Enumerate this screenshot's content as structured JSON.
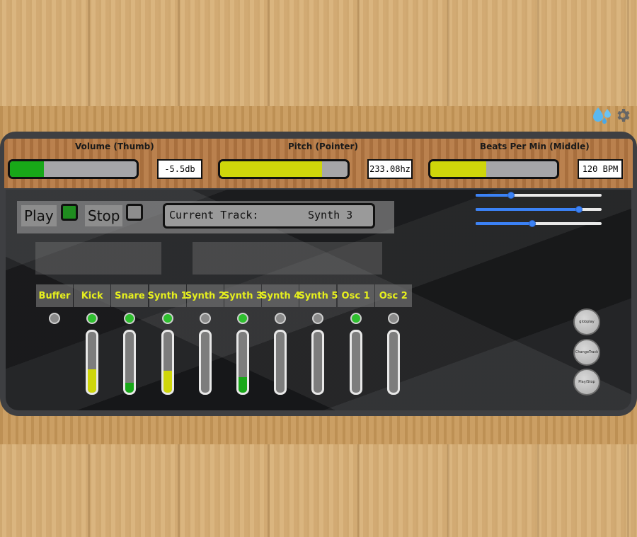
{
  "icons": [
    "water-drops-icon",
    "gear-icon"
  ],
  "header": {
    "meters": [
      {
        "label": "Volume (Thumb)",
        "readout": "-5.5db",
        "level": 0.27,
        "color": "#18a818"
      },
      {
        "label": "Pitch (Pointer)",
        "readout": "233.08hz",
        "level": 0.8,
        "color": "#cfd60a"
      },
      {
        "label": "Beats Per Min (Middle)",
        "readout": "120 BPM",
        "level": 0.44,
        "color": "#cfd60a"
      }
    ]
  },
  "transport": {
    "play_label": "Play",
    "play_active": true,
    "stop_label": "Stop",
    "stop_active": false,
    "current_track_label": "Current Track:",
    "current_track_value": "Synth 3"
  },
  "sliders": [
    0.28,
    0.82,
    0.45
  ],
  "channels": [
    {
      "name": "Buffer",
      "active": false,
      "level": null
    },
    {
      "name": "Kick",
      "active": true,
      "level": 0.38,
      "fill": "#cfd60a"
    },
    {
      "name": "Snare",
      "active": true,
      "level": 0.16,
      "fill": "#18a818"
    },
    {
      "name": "Synth 1",
      "active": true,
      "level": 0.36,
      "fill": "#cfd60a"
    },
    {
      "name": "Synth 2",
      "active": false,
      "level": 0
    },
    {
      "name": "Synth 3",
      "active": true,
      "level": 0.26,
      "fill": "#18a818"
    },
    {
      "name": "Synth 4",
      "active": false,
      "level": 0
    },
    {
      "name": "Synth 5",
      "active": false,
      "level": 0
    },
    {
      "name": "Osc 1",
      "active": true,
      "level": 0
    },
    {
      "name": "Osc 2",
      "active": false,
      "level": 0
    }
  ],
  "buttons": [
    {
      "label": "globplay"
    },
    {
      "label": "ChangeTrack"
    },
    {
      "label": "Play/Stop"
    }
  ],
  "colors": {
    "led_on": "#2fbf2f",
    "led_off": "#8a8a8a",
    "play_on": "#1f8c1f",
    "stop_off": "#8d8d8d"
  }
}
